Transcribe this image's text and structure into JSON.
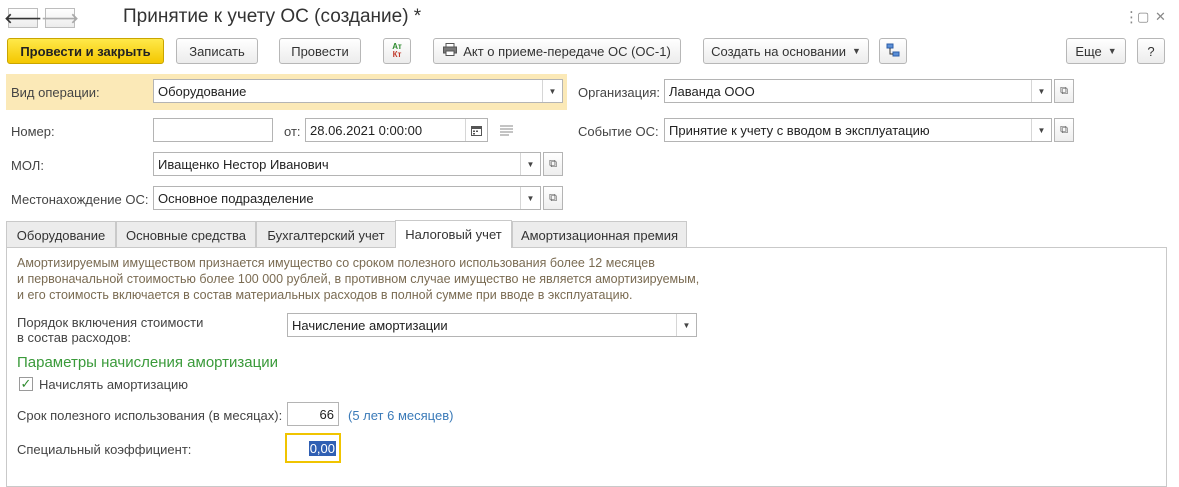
{
  "window": {
    "title": "Принятие к учету ОС (создание) *",
    "more_icon": "⋮",
    "maximize_icon": "▢",
    "close_icon": "✕"
  },
  "nav": {
    "back": "🡐",
    "forward": "🡒"
  },
  "toolbar": {
    "post_close": "Провести и закрыть",
    "save": "Записать",
    "post": "Провести",
    "dtkt_top": "Ат",
    "dtkt_bottom": "Кт",
    "act_label": "Акт о приеме-передаче ОС (ОС-1)",
    "create_based": "Создать на основании",
    "more": "Еще",
    "help": "?"
  },
  "fields": {
    "operation_label": "Вид операции:",
    "operation_value": "Оборудование",
    "number_label": "Номер:",
    "number_value": "",
    "from_label": "от:",
    "date_value": "28.06.2021  0:00:00",
    "mol_label": "МОЛ:",
    "mol_value": "Иващенко Нестор Иванович",
    "location_label": "Местонахождение ОС:",
    "location_value": "Основное подразделение",
    "org_label": "Организация:",
    "org_value": "Лаванда ООО",
    "event_label": "Событие ОС:",
    "event_value": "Принятие к учету с вводом в эксплуатацию"
  },
  "tabs": [
    {
      "label": "Оборудование"
    },
    {
      "label": "Основные средства"
    },
    {
      "label": "Бухгалтерский учет"
    },
    {
      "label": "Налоговый учет"
    },
    {
      "label": "Амортизационная премия"
    }
  ],
  "tax": {
    "note_line1": "Амортизируемым имуществом признается имущество со сроком полезного использования более 12 месяцев",
    "note_line2": "и первоначальной стоимостью более 100 000 рублей, в противном случае имущество не является амортизируемым,",
    "note_line3": "и его стоимость включается в состав материальных расходов в полной сумме при вводе в эксплуатацию.",
    "order_label_line1": "Порядок включения стоимости",
    "order_label_line2": "в состав расходов:",
    "order_value": "Начисление амортизации",
    "section_title": "Параметры начисления амортизации",
    "accrue_label": "Начислять амортизацию",
    "accrue_checked": true,
    "term_label": "Срок полезного использования (в месяцах):",
    "term_value": "66",
    "term_hint": "(5 лет 6 месяцев)",
    "coef_label": "Специальный коэффициент:",
    "coef_value": "0,00"
  },
  "colors": {
    "primary_button": "#f4c700",
    "highlight_row": "#fbe9b7",
    "section_title": "#3a9a3a",
    "focus_border": "#f0c400"
  }
}
